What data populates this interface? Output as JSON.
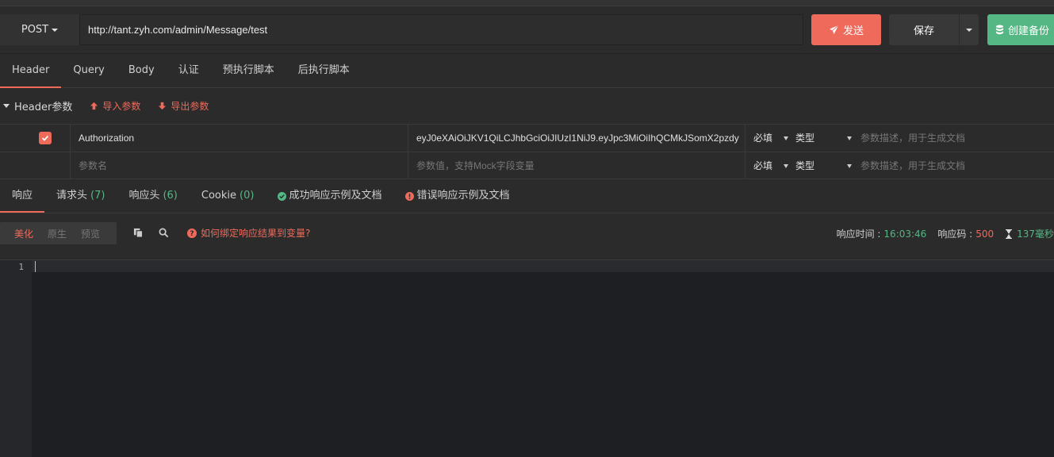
{
  "colors": {
    "accent": "#ef6a5b",
    "success": "#55b783",
    "background": "#2b2b2b",
    "editor": "#1e1f22"
  },
  "request": {
    "method": "POST",
    "url": "http://tant.zyh.com/admin/Message/test",
    "send_label": "发送",
    "save_label": "保存",
    "backup_label": "创建备份"
  },
  "request_tabs": [
    {
      "label": "Header",
      "active": true
    },
    {
      "label": "Query"
    },
    {
      "label": "Body"
    },
    {
      "label": "认证"
    },
    {
      "label": "预执行脚本"
    },
    {
      "label": "后执行脚本"
    }
  ],
  "params": {
    "title": "Header参数",
    "import_label": "导入参数",
    "export_label": "导出参数",
    "rows": [
      {
        "checked": true,
        "name": "Authorization",
        "value": "eyJ0eXAiOiJKV1QiLCJhbGciOiJIUzI1NiJ9.eyJpc3MiOiIhQCMkJSomX2pzdy",
        "required": "必填",
        "type": "类型",
        "desc_placeholder": "参数描述，用于生成文档"
      }
    ],
    "new_row": {
      "name_placeholder": "参数名",
      "value_placeholder": "参数值，支持Mock字段变量",
      "required": "必填",
      "type": "类型",
      "desc_placeholder": "参数描述，用于生成文档"
    }
  },
  "response_tabs": {
    "response": "响应",
    "request_headers": "请求头",
    "request_headers_count": "(7)",
    "response_headers": "响应头",
    "response_headers_count": "(6)",
    "cookie": "Cookie",
    "cookie_count": "(0)",
    "success_doc": "成功响应示例及文档",
    "error_doc": "错误响应示例及文档"
  },
  "response_toolbar": {
    "modes": [
      "美化",
      "原生",
      "预览"
    ],
    "active_mode": "美化",
    "bind_help": "如何绑定响应结果到变量?",
    "time_label": "响应时间 :",
    "time_value": "16:03:46",
    "code_label": "响应码 :",
    "code_value": "500",
    "duration": "137毫秒"
  },
  "editor": {
    "line_number": "1"
  }
}
